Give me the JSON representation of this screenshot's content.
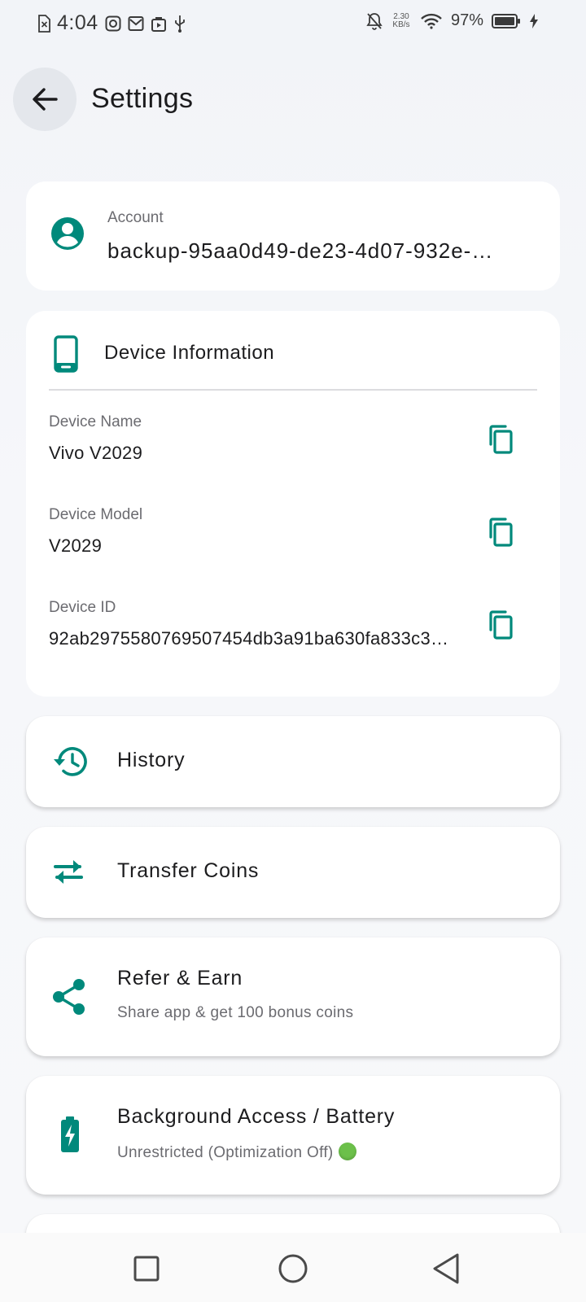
{
  "status_bar": {
    "time": "4:04",
    "net_speed_value": "2.30",
    "net_speed_unit": "KB/s",
    "battery_percent": "97%"
  },
  "header": {
    "title": "Settings",
    "back_icon": "arrow-back-icon"
  },
  "account": {
    "label": "Account",
    "value": "backup-95aa0d49-de23-4d07-932e-…",
    "icon": "account-circle-icon"
  },
  "device_info": {
    "title": "Device Information",
    "icon": "smartphone-icon",
    "rows": [
      {
        "label": "Device Name",
        "value": "Vivo V2029"
      },
      {
        "label": "Device Model",
        "value": "V2029"
      },
      {
        "label": "Device ID",
        "value": "92ab2975580769507454db3a91ba630fa833c3…"
      }
    ],
    "copy_icon": "copy-icon"
  },
  "menu": {
    "history": {
      "title": "History",
      "icon": "history-icon"
    },
    "transfer": {
      "title": "Transfer Coins",
      "icon": "swap-arrows-icon"
    },
    "refer": {
      "title": "Refer & Earn",
      "subtitle": "Share app & get 100 bonus coins",
      "icon": "share-icon"
    },
    "battery": {
      "title": "Background Access / Battery",
      "subtitle": "Unrestricted (Optimization Off)",
      "icon": "battery-charging-icon",
      "status_color": "#6cc04a"
    }
  },
  "colors": {
    "accent": "#00897b",
    "background": "#f6f7fa",
    "card": "#ffffff"
  }
}
